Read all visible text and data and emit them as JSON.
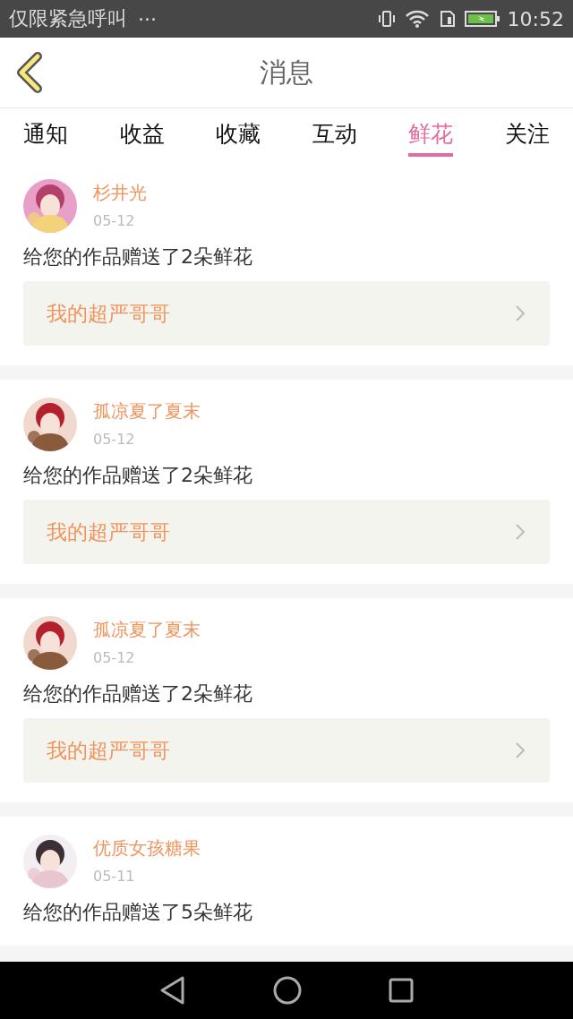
{
  "status_bar": {
    "carrier": "仅限紧急呼叫",
    "more": "···",
    "time": "10:52"
  },
  "header": {
    "title": "消息"
  },
  "tabs": [
    {
      "label": "通知",
      "selected": false
    },
    {
      "label": "收益",
      "selected": false
    },
    {
      "label": "收藏",
      "selected": false
    },
    {
      "label": "互动",
      "selected": false
    },
    {
      "label": "鲜花",
      "selected": true
    },
    {
      "label": "关注",
      "selected": false
    }
  ],
  "messages": [
    {
      "name": "杉井光",
      "date": "05-12",
      "text": "给您的作品赠送了2朵鲜花",
      "work": "我的超严哥哥"
    },
    {
      "name": "孤凉夏了夏末",
      "date": "05-12",
      "text": "给您的作品赠送了2朵鲜花",
      "work": "我的超严哥哥"
    },
    {
      "name": "孤凉夏了夏末",
      "date": "05-12",
      "text": "给您的作品赠送了2朵鲜花",
      "work": "我的超严哥哥"
    },
    {
      "name": "优质女孩糖果",
      "date": "05-11",
      "text": "给您的作品赠送了5朵鲜花"
    }
  ]
}
